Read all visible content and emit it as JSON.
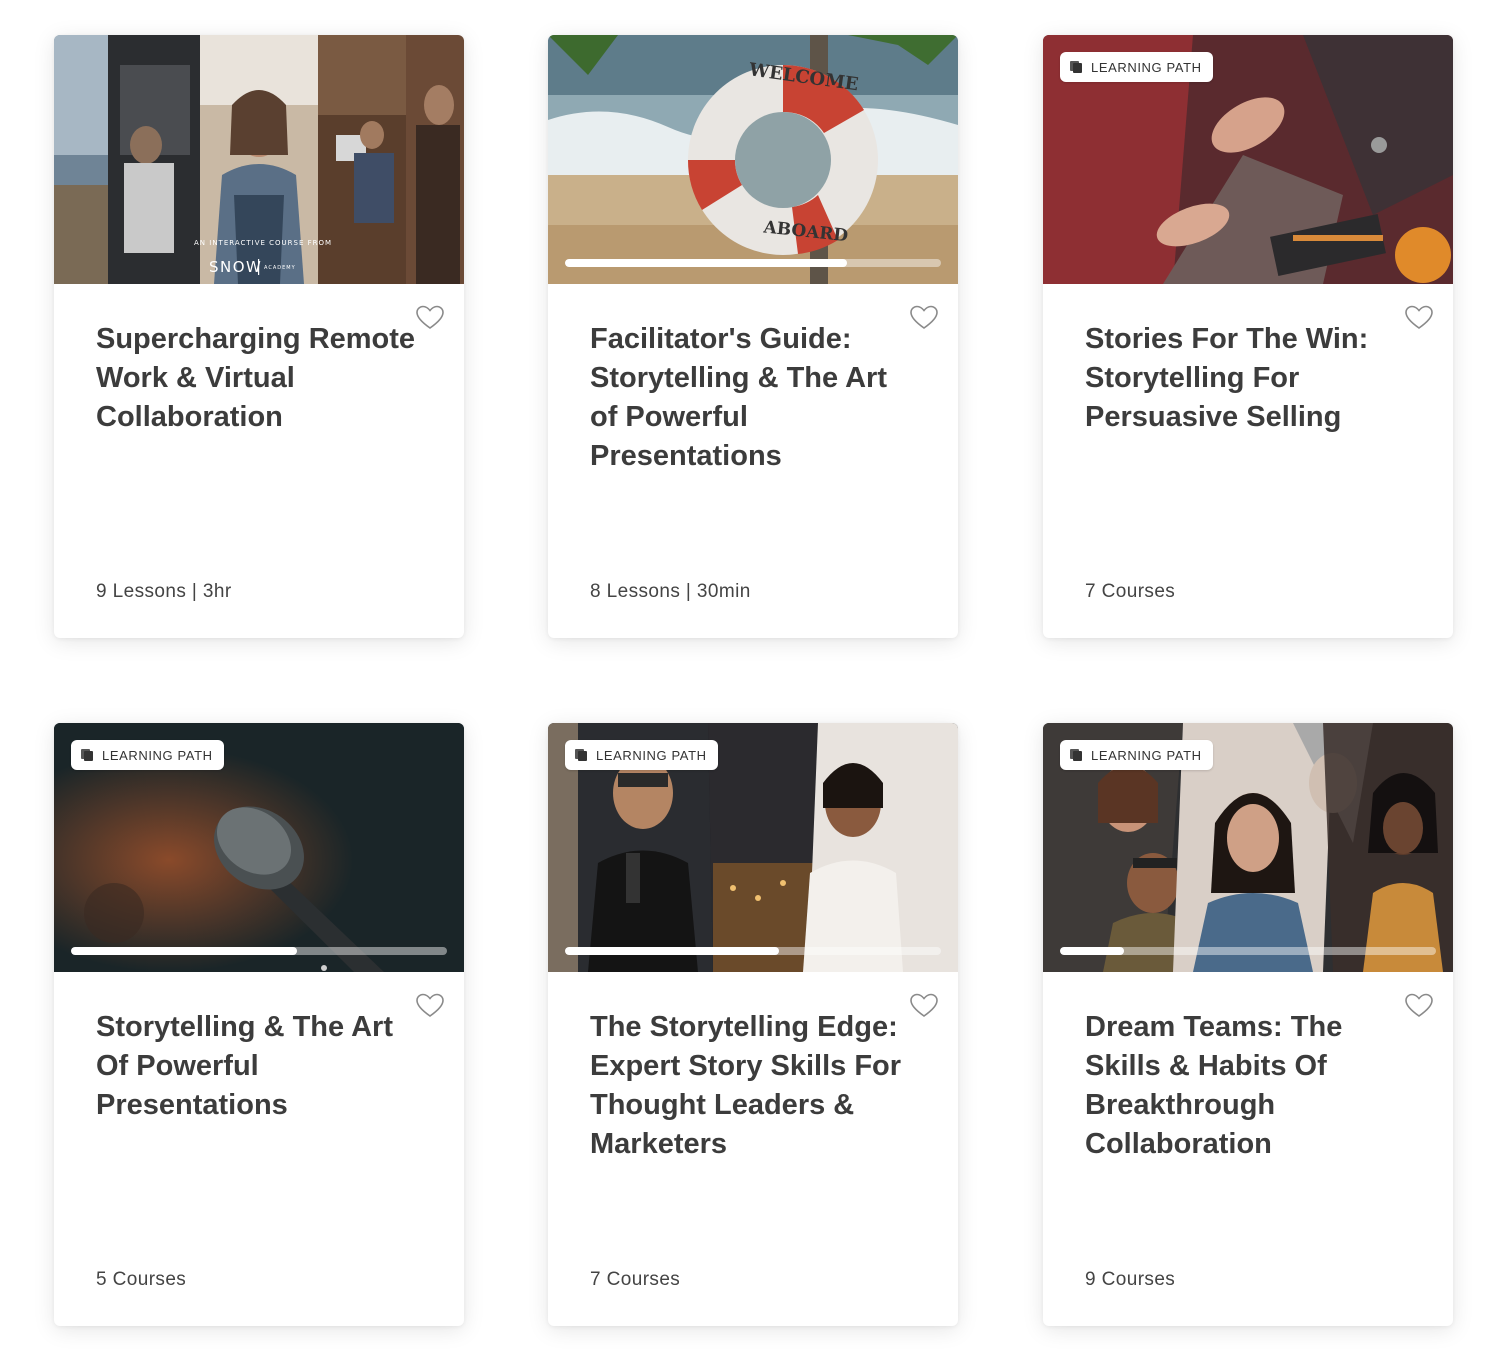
{
  "cards": [
    {
      "title": "Supercharging Remote Work & Virtual Collaboration",
      "meta": "9 Lessons | 3hr",
      "badge": "",
      "progress": null,
      "image_text": [
        "AN INTERACTIVE COURSE FROM",
        "SNOW",
        "ACADEMY"
      ],
      "image_icon": "collage-remote-workers-image"
    },
    {
      "title": "Facilitator's Guide: Storytelling & The Art of Powerful Presentations",
      "meta": "8 Lessons | 30min",
      "badge": "",
      "progress": 0.75,
      "image_text": [
        "WELCOME",
        "ABOARD"
      ],
      "image_icon": "lifebuoy-beach-image"
    },
    {
      "title": "Stories For The Win: Storytelling For Persuasive Selling",
      "meta": "7 Courses",
      "badge": "LEARNING PATH",
      "progress": null,
      "image_icon": "business-meeting-hands-image"
    },
    {
      "title": "Storytelling & The Art Of Powerful Presentations",
      "meta": "5 Courses",
      "badge": "LEARNING PATH",
      "progress": 0.6,
      "image_icon": "microphone-stage-image"
    },
    {
      "title": "The Storytelling Edge: Expert Story Skills For Thought Leaders & Marketers",
      "meta": "7 Courses",
      "badge": "LEARNING PATH",
      "progress": 0.57,
      "image_icon": "speakers-collage-image"
    },
    {
      "title": "Dream Teams: The Skills & Habits Of Breakthrough Collaboration",
      "meta": "9 Courses",
      "badge": "LEARNING PATH",
      "progress": 0.17,
      "image_icon": "diverse-faces-collage-image"
    }
  ],
  "colors": {
    "title": "#3c3c3c",
    "meta": "#444444",
    "card_bg": "#ffffff",
    "heart_stroke": "#8a8a8a"
  }
}
